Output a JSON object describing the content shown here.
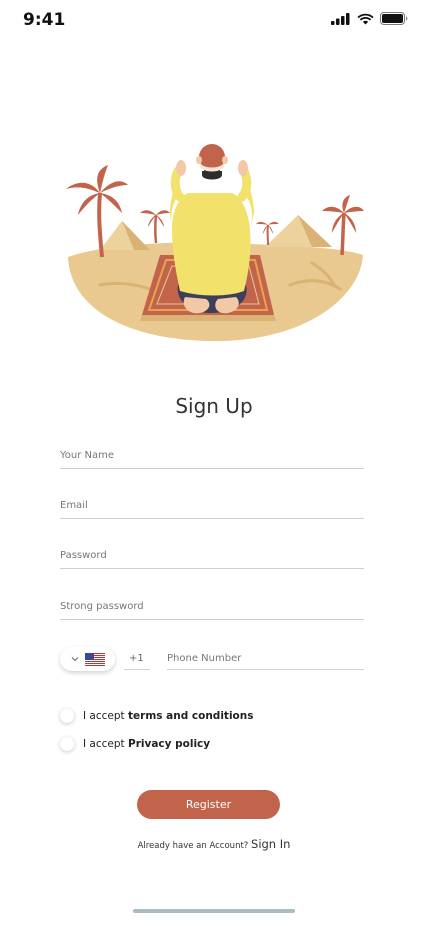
{
  "status": {
    "time": "9:41"
  },
  "form": {
    "title": "Sign Up",
    "name_placeholder": "Your Name",
    "email_placeholder": "Email",
    "password_placeholder": "Password",
    "confirm_placeholder": "Strong password",
    "dial_code": "+1",
    "phone_placeholder": "Phone Number",
    "terms_prefix": "I accept ",
    "terms_link": "terms and conditions",
    "privacy_prefix": "I accept ",
    "privacy_link": "Privacy policy",
    "register_label": "Register",
    "account_prompt": "Already have an Account? ",
    "signin_label": "Sign In"
  },
  "colors": {
    "accent": "#c2644b",
    "sand": "#e9c98f",
    "shirt": "#f2e16b",
    "home_indicator": "#a9bcc0"
  },
  "icons": [
    "signal-icon",
    "wifi-icon",
    "battery-icon",
    "chevron-down-icon",
    "us-flag-icon",
    "prayer-illustration"
  ]
}
